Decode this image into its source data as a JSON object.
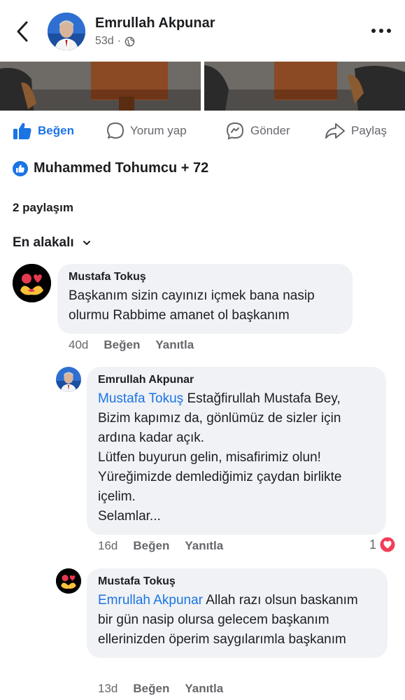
{
  "header": {
    "name": "Emrullah Akpunar",
    "time": "53d",
    "separator": "·"
  },
  "actions": {
    "like": "Beğen",
    "comment": "Yorum yap",
    "send": "Gönder",
    "share": "Paylaş"
  },
  "reactions": {
    "text": "Muhammed Tohumcu + 72"
  },
  "shares": {
    "text": "2 paylaşım"
  },
  "sort": {
    "label": "En alakalı"
  },
  "comments": [
    {
      "author": "Mustafa Tokuş",
      "text": "Başkanım sizin cayınızı içmek bana nasip olurmu Rabbime amanet ol başkanım",
      "time": "40d",
      "like": "Beğen",
      "reply": "Yanıtla"
    },
    {
      "author": "Emrullah Akpunar",
      "mention": "Mustafa Tokuş",
      "lines": [
        "Estağfirullah Mustafa Bey,",
        "Bizim kapımız da, gönlümüz de sizler için ardına kadar açık.",
        "Lütfen buyurun gelin, misafirimiz olun!",
        "Yüreğimizde demlediğimiz çaydan birlikte içelim.",
        "Selamlar..."
      ],
      "time": "16d",
      "like": "Beğen",
      "reply": "Yanıtla",
      "reaction_count": "1"
    },
    {
      "author": "Mustafa Tokuş",
      "mention": "Emrullah Akpunar",
      "text": "Allah razı olsun baskanım bir gün nasip olursa gelecem başkanım ellerinizden öperim saygılarımla başkanım",
      "time": "13d",
      "like": "Beğen",
      "reply": "Yanıtla"
    }
  ],
  "colors": {
    "accent": "#1b74e4",
    "muted": "#65676b",
    "bubble": "#f0f2f5",
    "heart": "#f33e58"
  },
  "icons": [
    "back-icon",
    "globe-icon",
    "more-icon",
    "like-icon",
    "comment-icon",
    "messenger-icon",
    "share-icon",
    "like-badge-icon",
    "chevron-down-icon",
    "heart-icon"
  ]
}
